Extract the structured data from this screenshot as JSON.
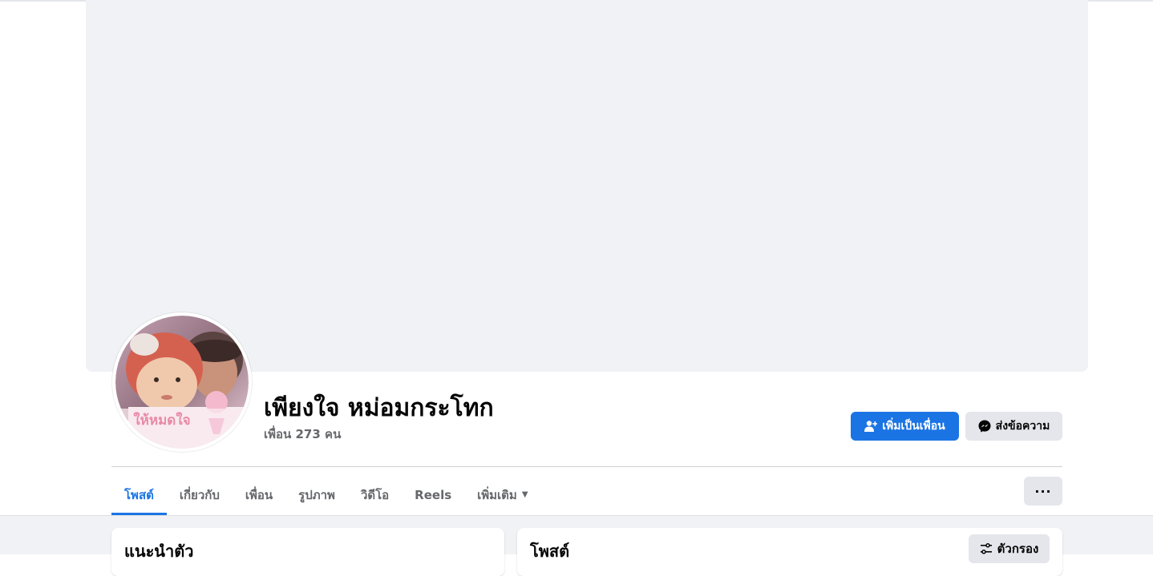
{
  "profile": {
    "name": "เพียงใจ หม่อมกระโทก",
    "friends_count": "เพื่อน 273 คน",
    "avatar_caption": "ให้หมดใจ"
  },
  "actions": {
    "add_friend_label": "เพิ่มเป็นเพื่อน",
    "add_friend_icon": "add-friend-icon",
    "message_label": "ส่งข้อความ",
    "message_icon": "messenger-icon",
    "more_label": "···"
  },
  "tabs": [
    {
      "label": "โพสต์",
      "active": true
    },
    {
      "label": "เกี่ยวกับ",
      "active": false
    },
    {
      "label": "เพื่อน",
      "active": false
    },
    {
      "label": "รูปภาพ",
      "active": false
    },
    {
      "label": "วิดีโอ",
      "active": false
    },
    {
      "label": "Reels",
      "active": false
    },
    {
      "label": "เพิ่มเติม",
      "active": false
    }
  ],
  "intro": {
    "title": "แนะนำตัว"
  },
  "posts": {
    "title": "โพสต์",
    "filter_label": "ตัวกรอง",
    "filter_icon": "filter-icon"
  },
  "colors": {
    "accent": "#1b74e4",
    "background": "#f0f2f5",
    "secondary_button": "#e4e6eb",
    "muted_text": "#65676b"
  }
}
